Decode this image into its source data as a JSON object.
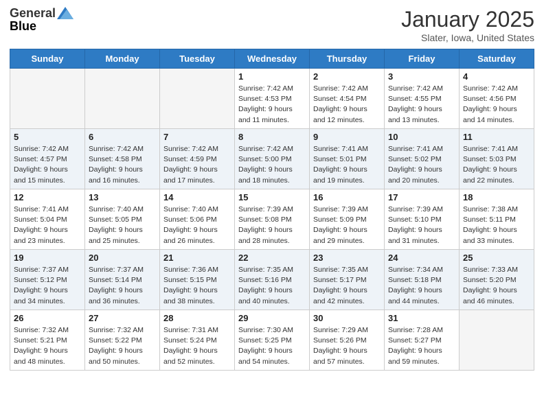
{
  "header": {
    "logo_general": "General",
    "logo_blue": "Blue",
    "month_title": "January 2025",
    "location": "Slater, Iowa, United States"
  },
  "days_of_week": [
    "Sunday",
    "Monday",
    "Tuesday",
    "Wednesday",
    "Thursday",
    "Friday",
    "Saturday"
  ],
  "weeks": [
    [
      {
        "day": "",
        "detail": ""
      },
      {
        "day": "",
        "detail": ""
      },
      {
        "day": "",
        "detail": ""
      },
      {
        "day": "1",
        "detail": "Sunrise: 7:42 AM\nSunset: 4:53 PM\nDaylight: 9 hours\nand 11 minutes."
      },
      {
        "day": "2",
        "detail": "Sunrise: 7:42 AM\nSunset: 4:54 PM\nDaylight: 9 hours\nand 12 minutes."
      },
      {
        "day": "3",
        "detail": "Sunrise: 7:42 AM\nSunset: 4:55 PM\nDaylight: 9 hours\nand 13 minutes."
      },
      {
        "day": "4",
        "detail": "Sunrise: 7:42 AM\nSunset: 4:56 PM\nDaylight: 9 hours\nand 14 minutes."
      }
    ],
    [
      {
        "day": "5",
        "detail": "Sunrise: 7:42 AM\nSunset: 4:57 PM\nDaylight: 9 hours\nand 15 minutes."
      },
      {
        "day": "6",
        "detail": "Sunrise: 7:42 AM\nSunset: 4:58 PM\nDaylight: 9 hours\nand 16 minutes."
      },
      {
        "day": "7",
        "detail": "Sunrise: 7:42 AM\nSunset: 4:59 PM\nDaylight: 9 hours\nand 17 minutes."
      },
      {
        "day": "8",
        "detail": "Sunrise: 7:42 AM\nSunset: 5:00 PM\nDaylight: 9 hours\nand 18 minutes."
      },
      {
        "day": "9",
        "detail": "Sunrise: 7:41 AM\nSunset: 5:01 PM\nDaylight: 9 hours\nand 19 minutes."
      },
      {
        "day": "10",
        "detail": "Sunrise: 7:41 AM\nSunset: 5:02 PM\nDaylight: 9 hours\nand 20 minutes."
      },
      {
        "day": "11",
        "detail": "Sunrise: 7:41 AM\nSunset: 5:03 PM\nDaylight: 9 hours\nand 22 minutes."
      }
    ],
    [
      {
        "day": "12",
        "detail": "Sunrise: 7:41 AM\nSunset: 5:04 PM\nDaylight: 9 hours\nand 23 minutes."
      },
      {
        "day": "13",
        "detail": "Sunrise: 7:40 AM\nSunset: 5:05 PM\nDaylight: 9 hours\nand 25 minutes."
      },
      {
        "day": "14",
        "detail": "Sunrise: 7:40 AM\nSunset: 5:06 PM\nDaylight: 9 hours\nand 26 minutes."
      },
      {
        "day": "15",
        "detail": "Sunrise: 7:39 AM\nSunset: 5:08 PM\nDaylight: 9 hours\nand 28 minutes."
      },
      {
        "day": "16",
        "detail": "Sunrise: 7:39 AM\nSunset: 5:09 PM\nDaylight: 9 hours\nand 29 minutes."
      },
      {
        "day": "17",
        "detail": "Sunrise: 7:39 AM\nSunset: 5:10 PM\nDaylight: 9 hours\nand 31 minutes."
      },
      {
        "day": "18",
        "detail": "Sunrise: 7:38 AM\nSunset: 5:11 PM\nDaylight: 9 hours\nand 33 minutes."
      }
    ],
    [
      {
        "day": "19",
        "detail": "Sunrise: 7:37 AM\nSunset: 5:12 PM\nDaylight: 9 hours\nand 34 minutes."
      },
      {
        "day": "20",
        "detail": "Sunrise: 7:37 AM\nSunset: 5:14 PM\nDaylight: 9 hours\nand 36 minutes."
      },
      {
        "day": "21",
        "detail": "Sunrise: 7:36 AM\nSunset: 5:15 PM\nDaylight: 9 hours\nand 38 minutes."
      },
      {
        "day": "22",
        "detail": "Sunrise: 7:35 AM\nSunset: 5:16 PM\nDaylight: 9 hours\nand 40 minutes."
      },
      {
        "day": "23",
        "detail": "Sunrise: 7:35 AM\nSunset: 5:17 PM\nDaylight: 9 hours\nand 42 minutes."
      },
      {
        "day": "24",
        "detail": "Sunrise: 7:34 AM\nSunset: 5:18 PM\nDaylight: 9 hours\nand 44 minutes."
      },
      {
        "day": "25",
        "detail": "Sunrise: 7:33 AM\nSunset: 5:20 PM\nDaylight: 9 hours\nand 46 minutes."
      }
    ],
    [
      {
        "day": "26",
        "detail": "Sunrise: 7:32 AM\nSunset: 5:21 PM\nDaylight: 9 hours\nand 48 minutes."
      },
      {
        "day": "27",
        "detail": "Sunrise: 7:32 AM\nSunset: 5:22 PM\nDaylight: 9 hours\nand 50 minutes."
      },
      {
        "day": "28",
        "detail": "Sunrise: 7:31 AM\nSunset: 5:24 PM\nDaylight: 9 hours\nand 52 minutes."
      },
      {
        "day": "29",
        "detail": "Sunrise: 7:30 AM\nSunset: 5:25 PM\nDaylight: 9 hours\nand 54 minutes."
      },
      {
        "day": "30",
        "detail": "Sunrise: 7:29 AM\nSunset: 5:26 PM\nDaylight: 9 hours\nand 57 minutes."
      },
      {
        "day": "31",
        "detail": "Sunrise: 7:28 AM\nSunset: 5:27 PM\nDaylight: 9 hours\nand 59 minutes."
      },
      {
        "day": "",
        "detail": ""
      }
    ]
  ]
}
